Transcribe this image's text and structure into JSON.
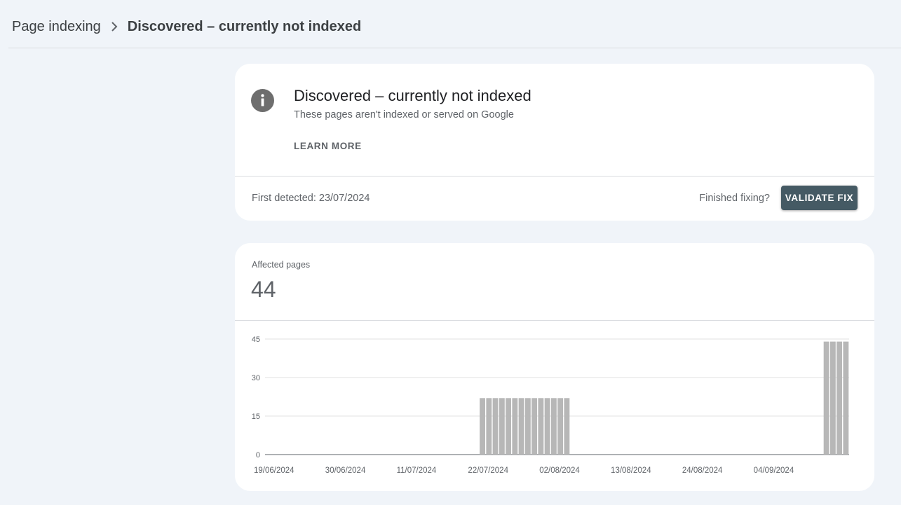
{
  "breadcrumb": {
    "parent": "Page indexing",
    "current": "Discovered – currently not indexed"
  },
  "issue_card": {
    "title": "Discovered – currently not indexed",
    "subtitle": "These pages aren't indexed or served on Google",
    "learn_more": "LEARN MORE",
    "first_detected": "First detected: 23/07/2024",
    "finished_fixing": "Finished fixing?",
    "validate_fix": "VALIDATE FIX",
    "icon": "info-icon"
  },
  "affected": {
    "label": "Affected pages",
    "count": "44"
  },
  "colors": {
    "background": "#f0f4f9",
    "card": "#ffffff",
    "button": "#455a64",
    "bar": "#b7b7b7"
  },
  "chart_data": {
    "type": "bar",
    "y_ticks": [
      0,
      15,
      30,
      45
    ],
    "ylim": [
      0,
      45
    ],
    "x_tick_labels": [
      "19/06/2024",
      "30/06/2024",
      "11/07/2024",
      "22/07/2024",
      "02/08/2024",
      "13/08/2024",
      "24/08/2024",
      "04/09/2024"
    ],
    "x_start": "19/06/2024",
    "x_end": "16/09/2024",
    "series": [
      {
        "values": [
          {
            "date": "22/07/2024",
            "value": 22
          },
          {
            "date": "23/07/2024",
            "value": 22
          },
          {
            "date": "24/07/2024",
            "value": 22
          },
          {
            "date": "25/07/2024",
            "value": 22
          },
          {
            "date": "26/07/2024",
            "value": 22
          },
          {
            "date": "27/07/2024",
            "value": 22
          },
          {
            "date": "28/07/2024",
            "value": 22
          },
          {
            "date": "29/07/2024",
            "value": 22
          },
          {
            "date": "30/07/2024",
            "value": 22
          },
          {
            "date": "31/07/2024",
            "value": 22
          },
          {
            "date": "01/08/2024",
            "value": 22
          },
          {
            "date": "02/08/2024",
            "value": 22
          },
          {
            "date": "03/08/2024",
            "value": 22
          },
          {
            "date": "04/08/2024",
            "value": 22
          },
          {
            "date": "13/09/2024",
            "value": 44
          },
          {
            "date": "14/09/2024",
            "value": 44
          },
          {
            "date": "15/09/2024",
            "value": 44
          },
          {
            "date": "16/09/2024",
            "value": 44
          }
        ]
      }
    ],
    "grid": true
  }
}
